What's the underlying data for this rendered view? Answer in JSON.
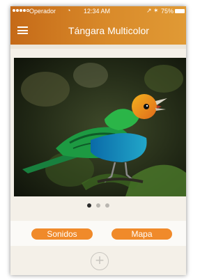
{
  "status_bar": {
    "carrier": "Operador",
    "time": "12:34 AM",
    "battery_percent": "75%",
    "wifi_icon": "wifi-icon",
    "location_icon": "location-arrow-icon",
    "bluetooth_icon": "bluetooth-icon"
  },
  "nav": {
    "title": "Tángara Multicolor",
    "menu_icon": "hamburger-menu-icon"
  },
  "gallery": {
    "image_subject": "bird-photo",
    "page_count": 3,
    "current_page": 1
  },
  "actions": {
    "sounds_label": "Sonidos",
    "map_label": "Mapa",
    "add_label": "+"
  },
  "colors": {
    "accent": "#f08a2a",
    "header": "#d0781f"
  }
}
